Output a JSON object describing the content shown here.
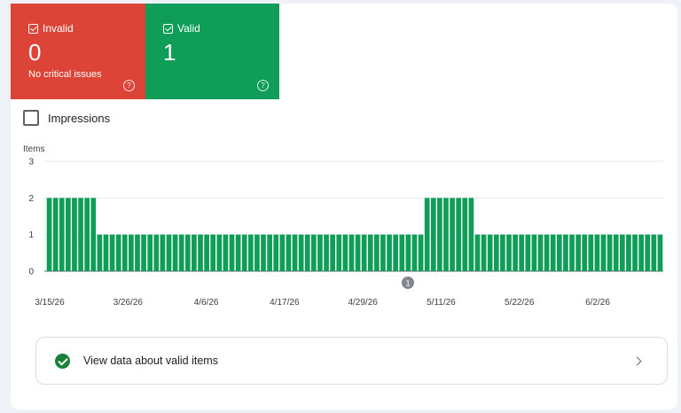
{
  "status_tiles": {
    "invalid": {
      "label": "Invalid",
      "count": "0",
      "subtitle": "No critical issues",
      "help": "?",
      "color": "#db4437"
    },
    "valid": {
      "label": "Valid",
      "count": "1",
      "help": "?",
      "color": "#0f9d58"
    }
  },
  "impressions_toggle": {
    "label": "Impressions",
    "checked": false
  },
  "chart_data": {
    "type": "bar",
    "ylabel": "Items",
    "ylim": [
      0,
      3
    ],
    "yticks": [
      "0",
      "1",
      "2",
      "3"
    ],
    "grid": true,
    "bar_color": "#0f9d58",
    "x_tick_labels": [
      "3/15/26",
      "3/26/26",
      "4/6/26",
      "4/17/26",
      "4/29/26",
      "5/11/26",
      "5/22/26",
      "6/2/26"
    ],
    "annotation": "1",
    "values": [
      2,
      2,
      2,
      2,
      2,
      2,
      2,
      2,
      1,
      1,
      1,
      1,
      1,
      1,
      1,
      1,
      1,
      1,
      1,
      1,
      1,
      1,
      1,
      1,
      1,
      1,
      1,
      1,
      1,
      1,
      1,
      1,
      1,
      1,
      1,
      1,
      1,
      1,
      1,
      1,
      1,
      1,
      1,
      1,
      1,
      1,
      1,
      1,
      1,
      1,
      1,
      1,
      1,
      1,
      1,
      1,
      1,
      1,
      1,
      1,
      2,
      2,
      2,
      2,
      2,
      2,
      2,
      2,
      1,
      1,
      1,
      1,
      1,
      1,
      1,
      1,
      1,
      1,
      1,
      1,
      1,
      1,
      1,
      1,
      1,
      1,
      1,
      1,
      1,
      1,
      1,
      1,
      1,
      1,
      1,
      1,
      1,
      1
    ]
  },
  "valid_link": {
    "label": "View data about valid items"
  }
}
